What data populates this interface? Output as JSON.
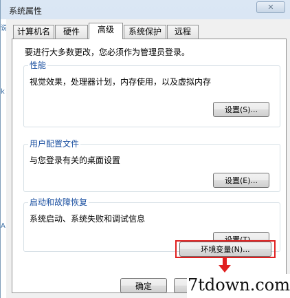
{
  "window": {
    "title": "系统属性",
    "close_glyph": "✕"
  },
  "behind_window": {
    "chars": [
      "说",
      "k",
      "A"
    ]
  },
  "tabs": [
    {
      "label": "计算机名"
    },
    {
      "label": "硬件"
    },
    {
      "label": "高级",
      "active": true
    },
    {
      "label": "系统保护"
    },
    {
      "label": "远程"
    }
  ],
  "admin_note": "要进行大多数更改，您必须作为管理员登录。",
  "performance": {
    "title": "性能",
    "description": "视觉效果，处理器计划，内存使用，以及虚拟内存",
    "button": "设置(S)..."
  },
  "user_profiles": {
    "title": "用户配置文件",
    "description": "与您登录有关的桌面设置",
    "button": "设置(E)..."
  },
  "startup_recovery": {
    "title": "启动和故障恢复",
    "description": "系统启动、系统失败和调试信息",
    "button": "设置(T)..."
  },
  "env_vars_button": "环境变量(N)...",
  "footer": {
    "ok_button": "确定"
  },
  "watermark": "7tdown.com",
  "colors": {
    "highlight": "#e02020",
    "group_title": "#1a4fa0"
  }
}
